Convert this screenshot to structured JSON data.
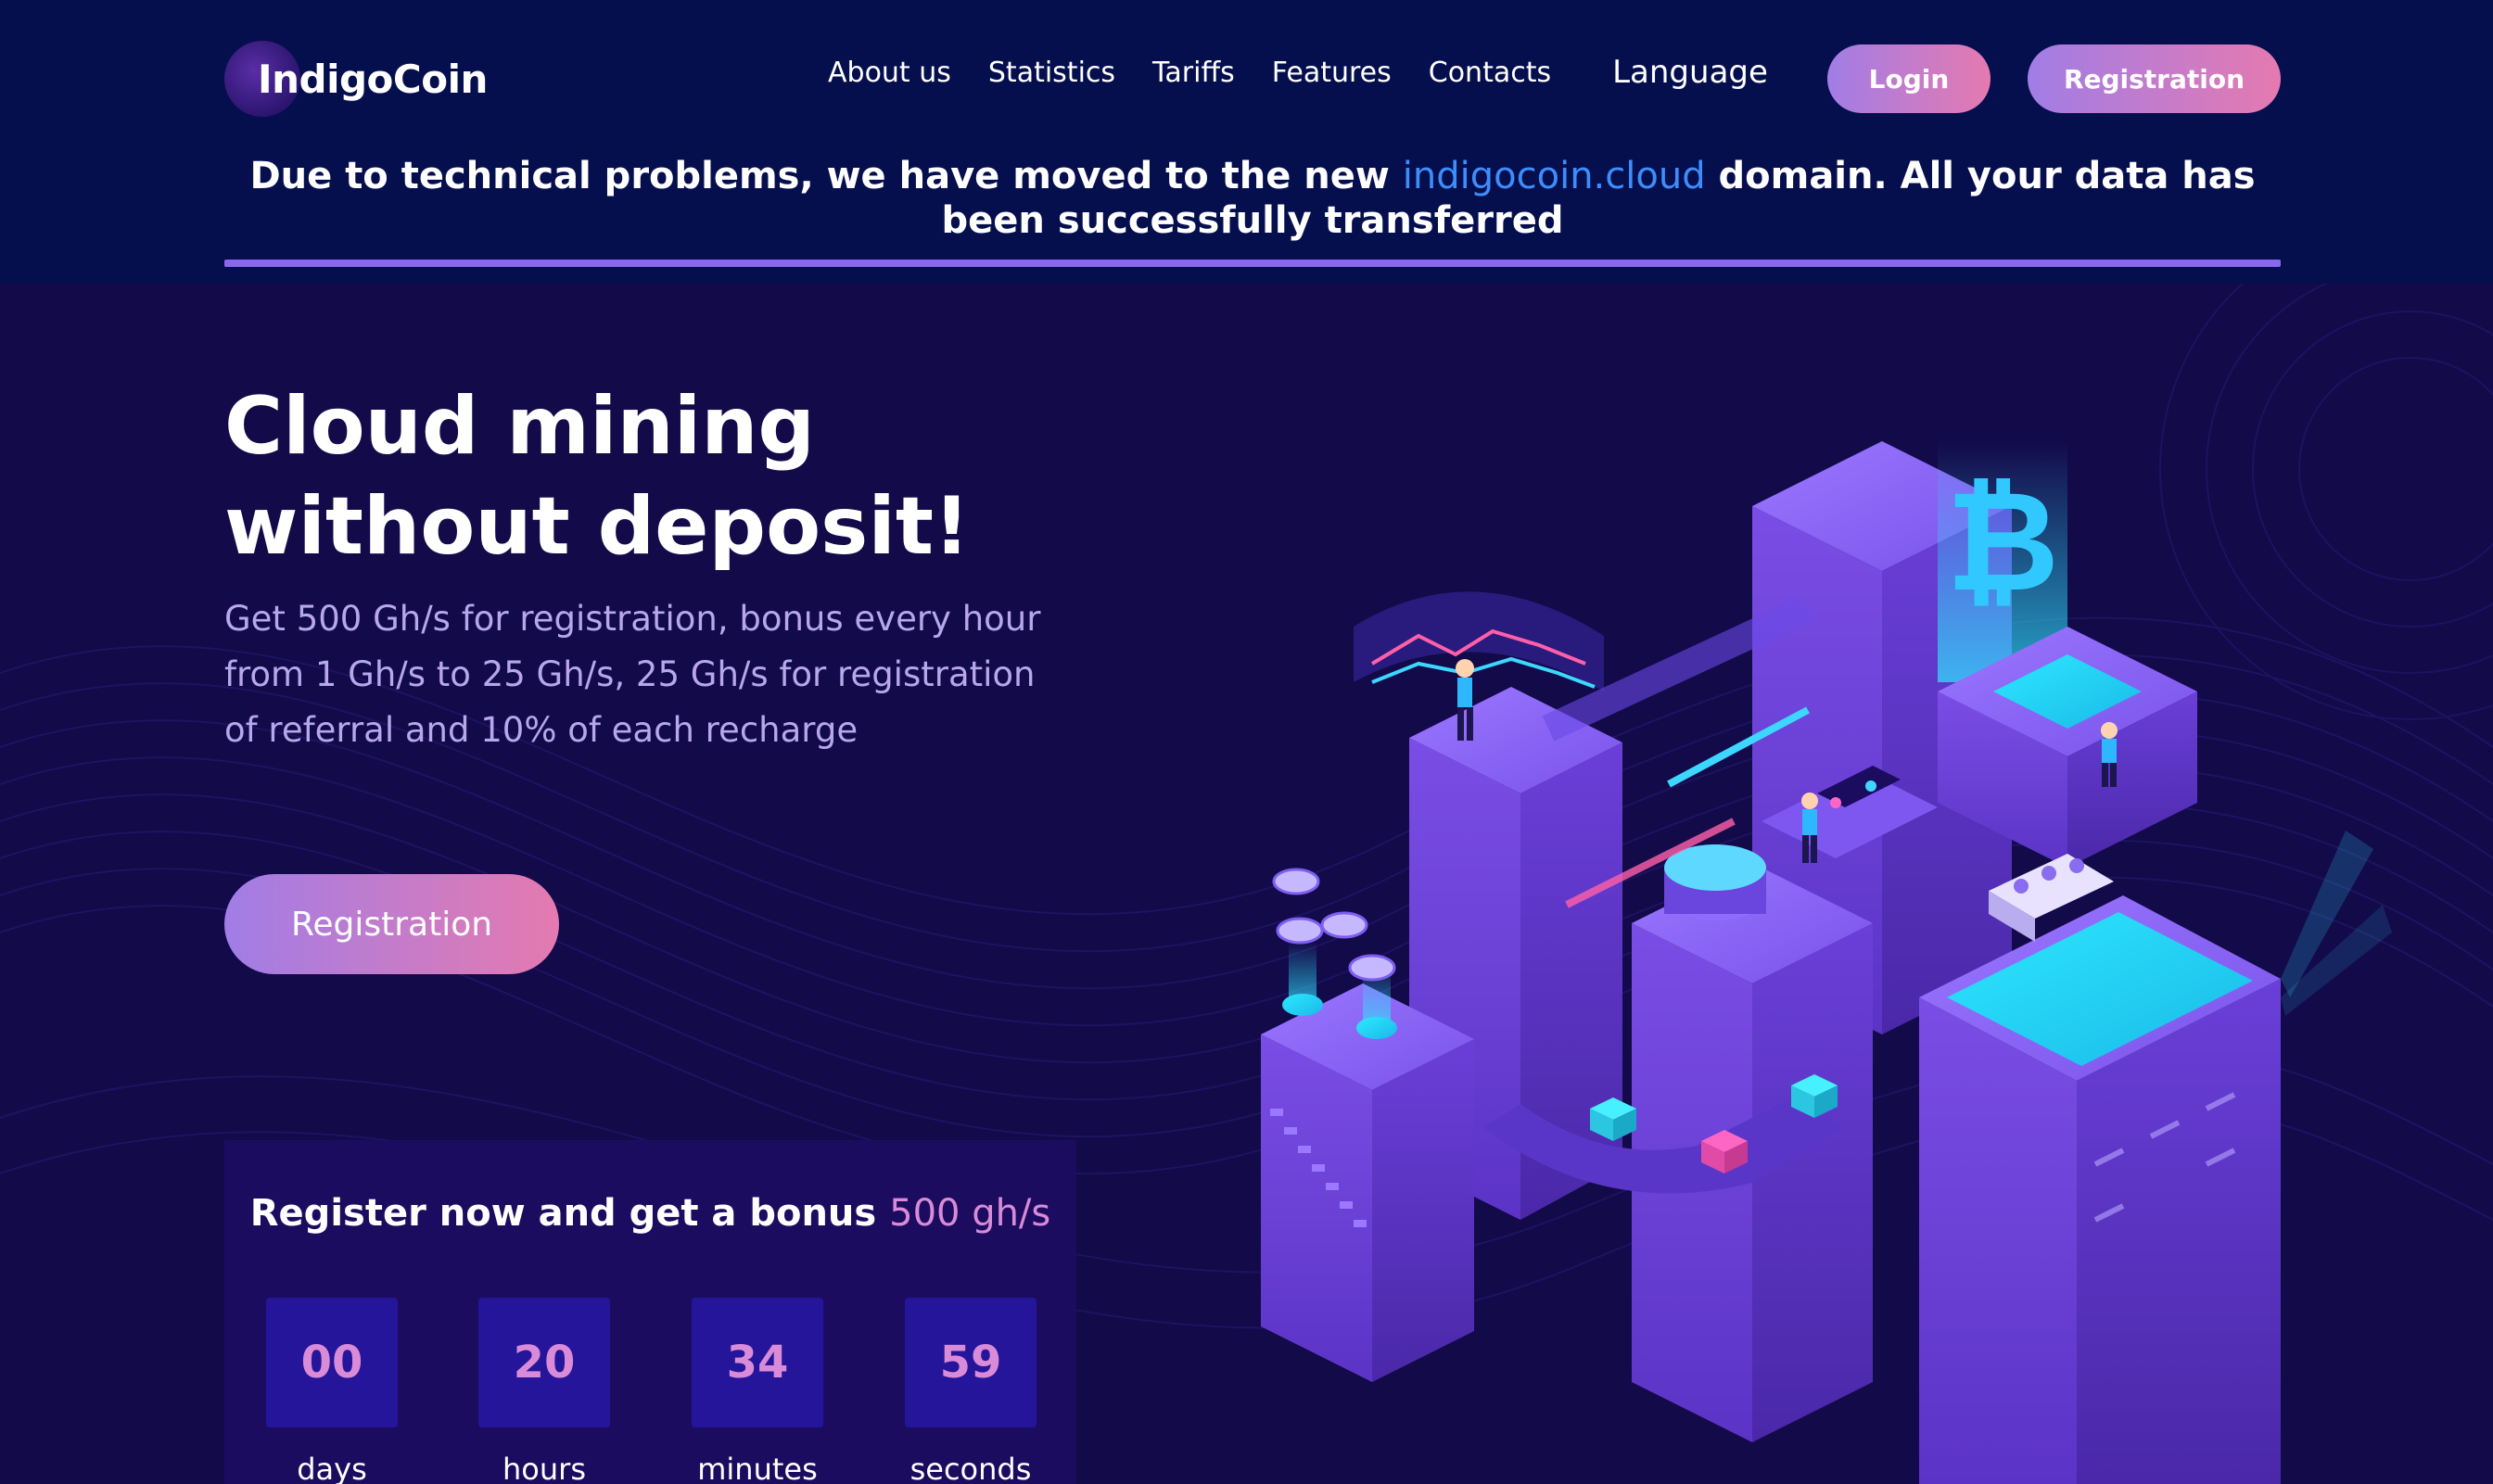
{
  "header": {
    "logo_text": "IndigoCoin",
    "nav": [
      {
        "label": "About us"
      },
      {
        "label": "Statistics"
      },
      {
        "label": "Tariffs"
      },
      {
        "label": "Features"
      },
      {
        "label": "Contacts"
      }
    ],
    "language_label": "Language",
    "login_label": "Login",
    "register_label": "Registration"
  },
  "notice": {
    "text_before": "Due to technical problems, we have moved to the new ",
    "domain": "indigocoin.cloud",
    "text_after": " domain. All your data has been successfully transferred"
  },
  "hero": {
    "title_line1": "Cloud mining",
    "title_line2": "without deposit!",
    "description": "Get 500 Gh/s for registration, bonus every hour from 1 Gh/s to 25 Gh/s, 25 Gh/s for registration of referral and 10% of each recharge",
    "cta_label": "Registration"
  },
  "bonus": {
    "title_prefix": "Register now and get a bonus ",
    "title_accent": "500 gh/s",
    "timer": [
      {
        "value": "00",
        "label": "days"
      },
      {
        "value": "20",
        "label": "hours"
      },
      {
        "value": "34",
        "label": "minutes"
      },
      {
        "value": "59",
        "label": "seconds"
      }
    ]
  },
  "colors": {
    "header_bg": "#060f4e",
    "hero_bg": "#130a4a",
    "accent_gradient_start": "#a17de6",
    "accent_gradient_end": "#e57ab0",
    "link_blue": "#3d8dfc",
    "timer_digit": "#d98bd8"
  }
}
